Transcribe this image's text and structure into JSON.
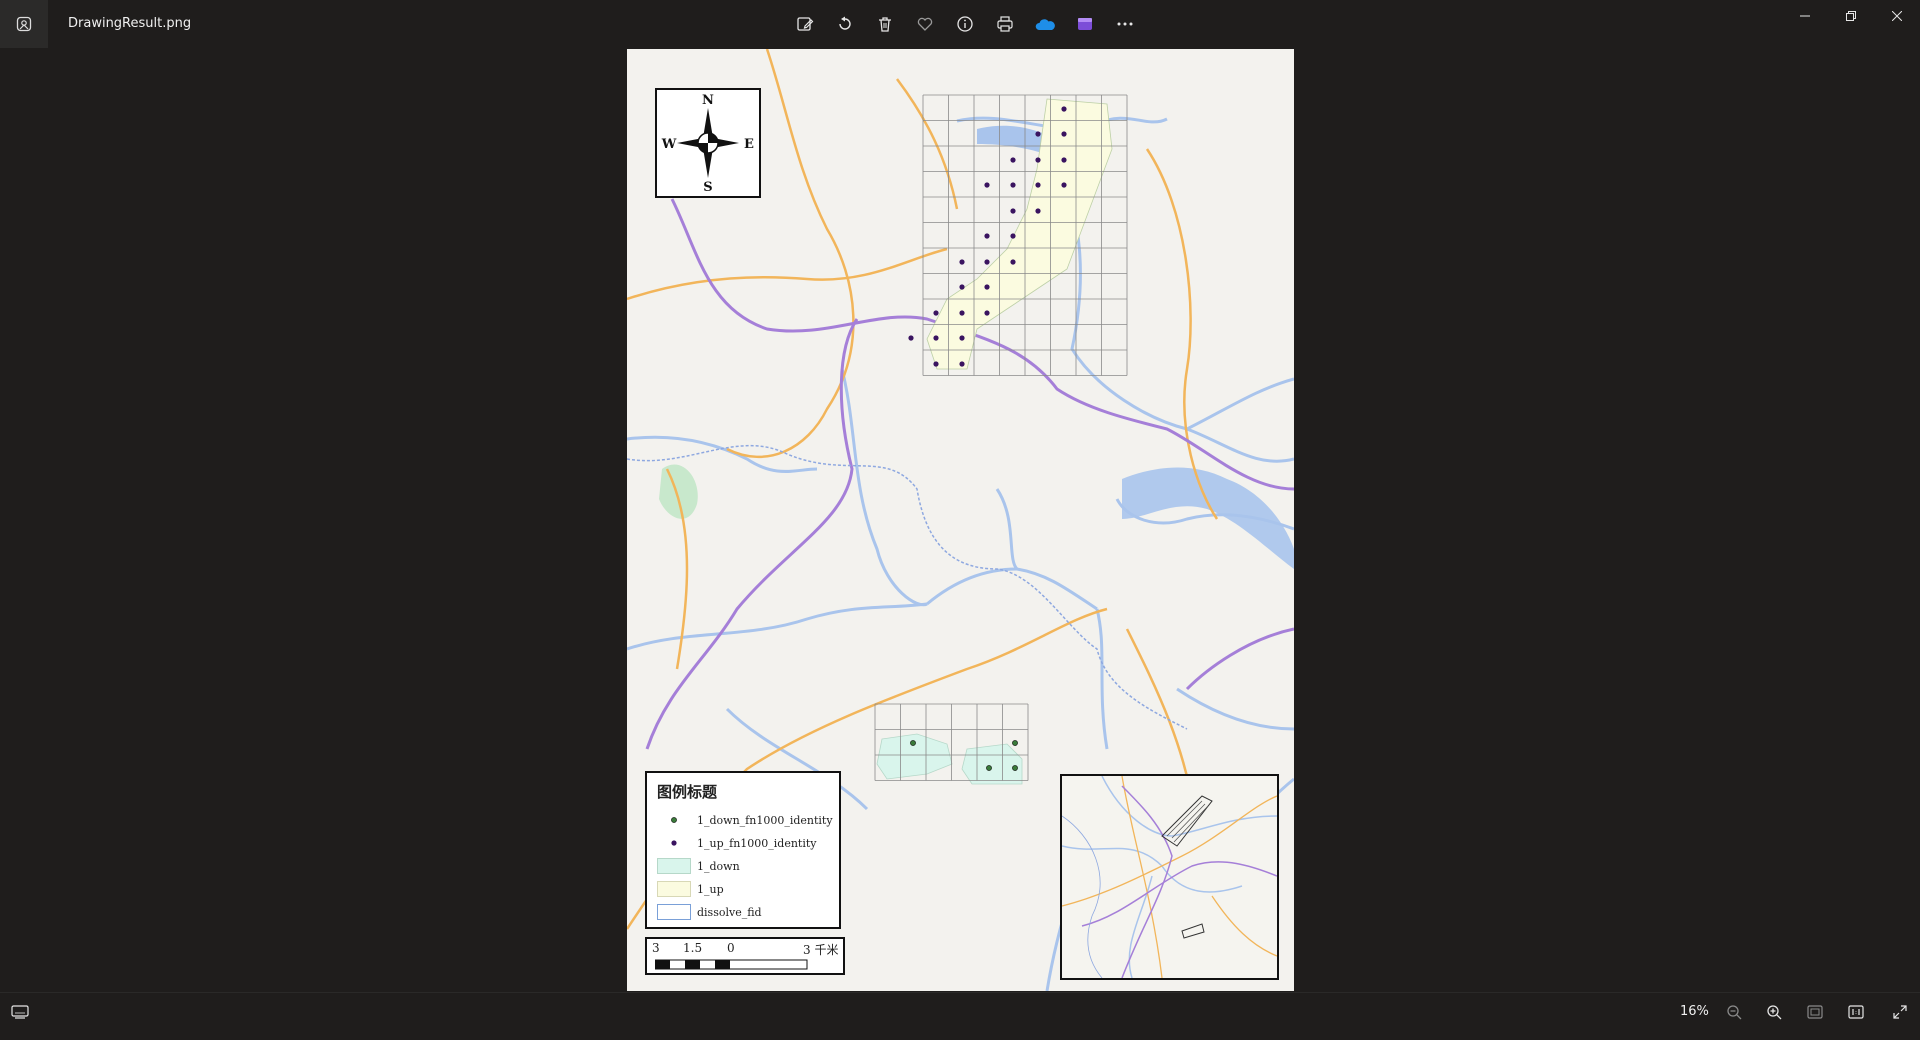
{
  "window": {
    "filename": "DrawingResult.png"
  },
  "toolbar": {
    "items": [
      {
        "name": "edit-image-icon"
      },
      {
        "name": "rotate-icon"
      },
      {
        "name": "delete-icon"
      },
      {
        "name": "favorite-icon"
      },
      {
        "name": "info-icon"
      },
      {
        "name": "print-icon"
      },
      {
        "name": "onedrive-icon"
      },
      {
        "name": "clipchamp-icon"
      },
      {
        "name": "more-icon"
      }
    ]
  },
  "status": {
    "zoom": "16%"
  },
  "map": {
    "compass": {
      "n": "N",
      "s": "S",
      "e": "E",
      "w": "W"
    },
    "legend": {
      "title": "图例标题",
      "items": [
        {
          "label": "1_down_fn1000_identity",
          "kind": "point",
          "color": "#3a7a3a"
        },
        {
          "label": "1_up_fn1000_identity",
          "kind": "point",
          "color": "#3a1460"
        },
        {
          "label": "1_down",
          "kind": "fill",
          "color": "#d9f5ec"
        },
        {
          "label": "1_up",
          "kind": "fill",
          "color": "#fbfbe0"
        },
        {
          "label": "dissolve_fid",
          "kind": "outline",
          "color": "#7aa0d8"
        }
      ]
    },
    "scale": {
      "labels": [
        "3",
        "1.5",
        "0",
        "3 千米"
      ]
    }
  },
  "colors": {
    "background": "#1f1d1c",
    "map_land": "#f3f2ee",
    "river": "#a9c4ec",
    "highway": "#f2b55a",
    "expressway": "#a57fd8"
  }
}
